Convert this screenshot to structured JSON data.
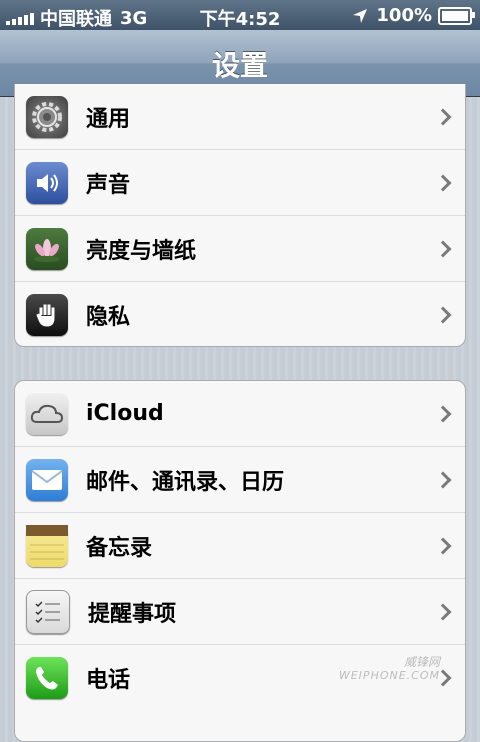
{
  "status": {
    "carrier": "中国联通",
    "network": "3G",
    "time": "下午4:52",
    "battery": "100%",
    "battery_level": 1.0,
    "signal_bars": 5,
    "icons": [
      "signal-bars-icon",
      "location-arrow-icon",
      "battery-icon"
    ]
  },
  "nav": {
    "title": "设置"
  },
  "group1": {
    "items": [
      {
        "label": "通用",
        "icon": "gear-icon"
      },
      {
        "label": "声音",
        "icon": "speaker-icon"
      },
      {
        "label": "亮度与墙纸",
        "icon": "flower-wallpaper-icon"
      },
      {
        "label": "隐私",
        "icon": "hand-privacy-icon"
      }
    ]
  },
  "group2": {
    "items": [
      {
        "label": "iCloud",
        "icon": "cloud-icon"
      },
      {
        "label": "邮件、通讯录、日历",
        "icon": "mail-envelope-icon"
      },
      {
        "label": "备忘录",
        "icon": "notes-icon"
      },
      {
        "label": "提醒事项",
        "icon": "reminders-checklist-icon"
      },
      {
        "label": "电话",
        "icon": "phone-icon"
      }
    ]
  },
  "watermark": {
    "line1": "威锋网",
    "line2": "WEIPHONE.COM"
  },
  "colors": {
    "navbar": "#6d87a3",
    "statusbar": "#3e5367",
    "background": "#c5ccd4",
    "group_bg": "#f7f7f7",
    "chevron": "#7a7a7a"
  }
}
